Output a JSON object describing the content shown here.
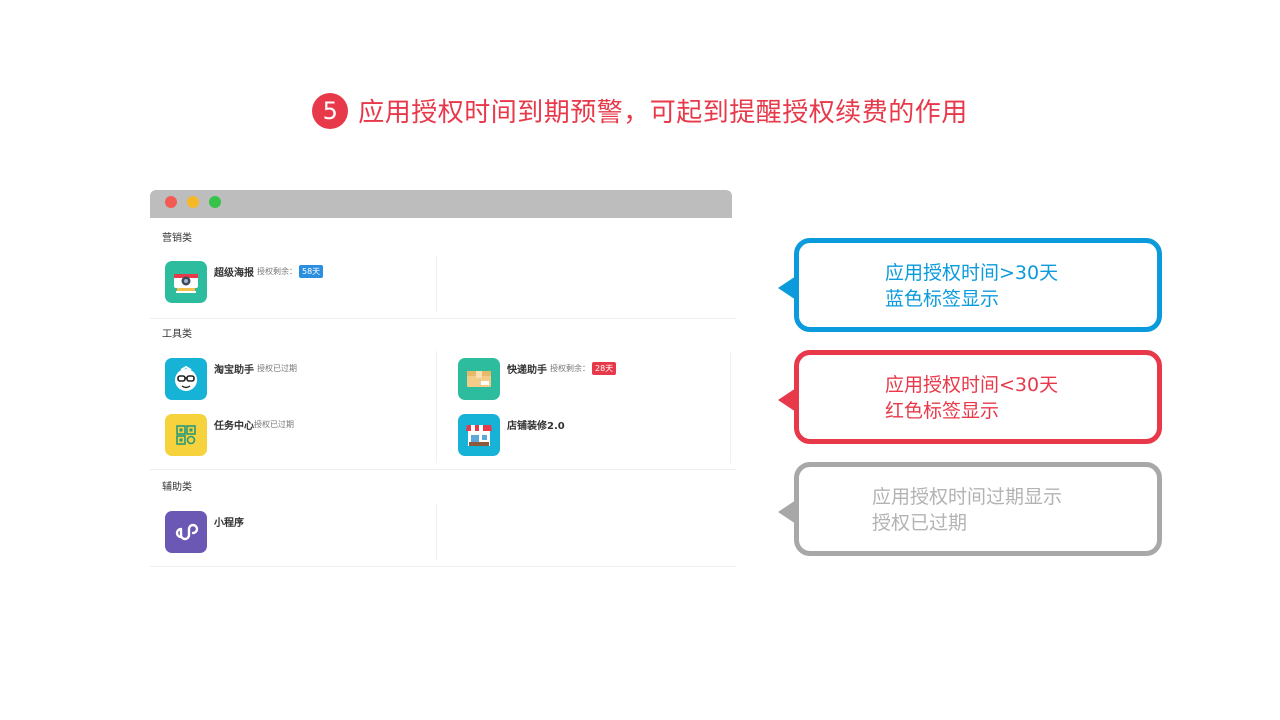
{
  "heading": {
    "step": "5",
    "text": "应用授权时间到期预警，可起到提醒授权续费的作用"
  },
  "window": {
    "categories": [
      {
        "label": "营销类",
        "apps": [
          {
            "name": "超级海报",
            "status": "授权剩余：",
            "badge": "58天",
            "badge_color": "#2b8fe0",
            "icon": "poster-camera-icon"
          }
        ]
      },
      {
        "label": "工具类",
        "apps": [
          {
            "name": "淘宝助手",
            "status": "授权已过期",
            "icon": "taobao-helper-icon"
          },
          {
            "name": "快递助手",
            "status": "授权剩余：",
            "badge": "28天",
            "badge_color": "#e8394a",
            "icon": "delivery-box-icon"
          },
          {
            "name": "任务中心",
            "status": "授权已过期",
            "icon": "task-center-icon"
          },
          {
            "name": "店铺装修2.0",
            "status": "",
            "icon": "shop-decor-icon"
          }
        ]
      },
      {
        "label": "辅助类",
        "apps": [
          {
            "name": "小程序",
            "status": "",
            "icon": "mini-program-icon"
          }
        ]
      }
    ]
  },
  "callouts": [
    {
      "line1": "应用授权时间>30天",
      "line2": "蓝色标签显示",
      "color": "#0b9bdc"
    },
    {
      "line1": "应用授权时间<30天",
      "line2": "红色标签显示",
      "color": "#e8394a"
    },
    {
      "line1": "应用授权时间过期显示",
      "line2": "授权已过期",
      "color": "#a8a8a8"
    }
  ]
}
